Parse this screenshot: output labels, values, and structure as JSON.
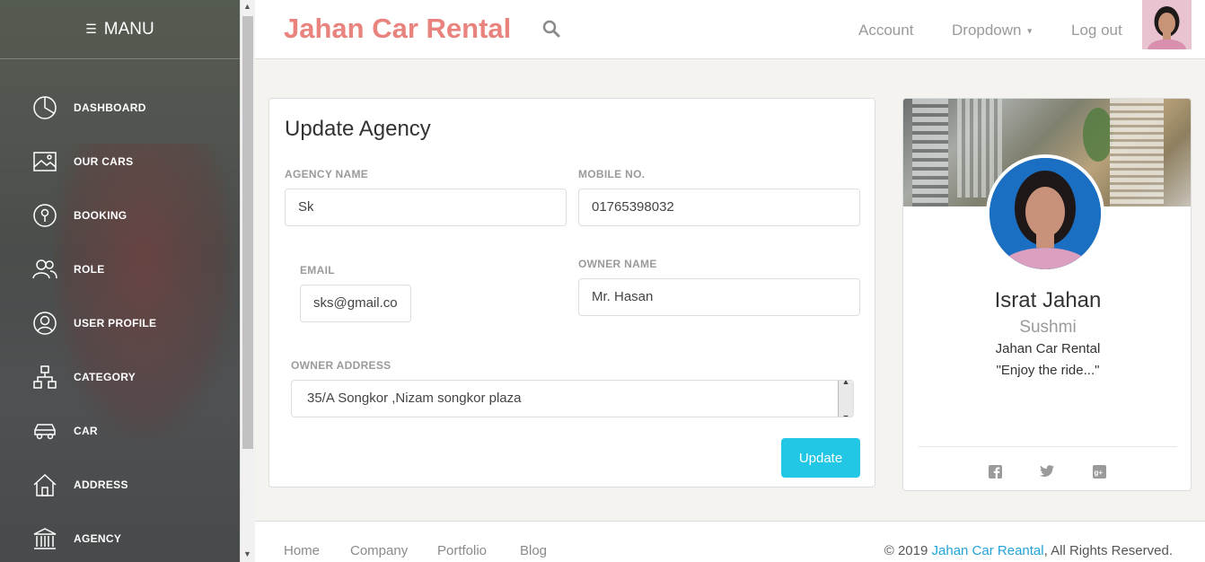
{
  "sidebar": {
    "brand": "MANU",
    "items": [
      {
        "label": "DASHBOARD",
        "icon": "pie-chart-icon"
      },
      {
        "label": "OUR CARS",
        "icon": "image-icon"
      },
      {
        "label": "BOOKING",
        "icon": "key-icon"
      },
      {
        "label": "ROLE",
        "icon": "users-icon"
      },
      {
        "label": "USER PROFILE",
        "icon": "user-icon"
      },
      {
        "label": "CATEGORY",
        "icon": "sitemap-icon"
      },
      {
        "label": "CAR",
        "icon": "car-icon"
      },
      {
        "label": "ADDRESS",
        "icon": "home-icon"
      },
      {
        "label": "AGENCY",
        "icon": "bank-icon"
      }
    ]
  },
  "topbar": {
    "title": "Jahan Car Rental",
    "account": "Account",
    "dropdown": "Dropdown",
    "logout": "Log out"
  },
  "form": {
    "heading": "Update Agency",
    "agency_name_label": "AGENCY NAME",
    "agency_name_value": "Sk",
    "mobile_label": "MOBILE NO.",
    "mobile_value": "01765398032",
    "email_label": "EMAIL",
    "email_value": "sks@gmail.co",
    "owner_name_label": "OWNER NAME",
    "owner_name_value": "Mr. Hasan",
    "owner_address_label": "OWNER ADDRESS",
    "owner_address_value": "35/A Songkor ,Nizam songkor plaza",
    "update_label": "Update"
  },
  "profile": {
    "name": "Israt Jahan",
    "nickname": "Sushmi",
    "company": "Jahan Car Rental",
    "tagline": "\"Enjoy the ride...\""
  },
  "footer": {
    "links": [
      "Home",
      "Company",
      "Portfolio",
      "Blog"
    ],
    "copy_prefix": "© 2019",
    "copy_brand": "Jahan Car Reantal",
    "copy_suffix": ", All Rights Reserved."
  },
  "colors": {
    "brand": "#e8837e",
    "accent": "#22c7e6",
    "link": "#22a3d8"
  }
}
